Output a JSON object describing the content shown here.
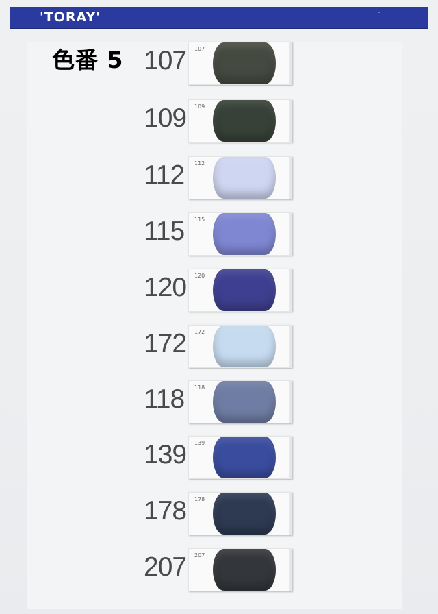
{
  "header": {
    "brand": "'TORAY'"
  },
  "title": "色番 5",
  "swatches": [
    {
      "code": "107",
      "label": "107",
      "color": "#444a40"
    },
    {
      "code": "109",
      "label": "109",
      "color": "#374137"
    },
    {
      "code": "112",
      "label": "112",
      "color": "#cfd6f1"
    },
    {
      "code": "115",
      "label": "115",
      "color": "#7f87d3"
    },
    {
      "code": "120",
      "label": "120",
      "color": "#3e3f90"
    },
    {
      "code": "172",
      "label": "172",
      "color": "#c6dbf0"
    },
    {
      "code": "118",
      "label": "118",
      "color": "#6f7da4"
    },
    {
      "code": "139",
      "label": "139",
      "color": "#3a4c9e"
    },
    {
      "code": "178",
      "label": "178",
      "color": "#2e3a52"
    },
    {
      "code": "207",
      "label": "207",
      "color": "#33363a"
    }
  ]
}
